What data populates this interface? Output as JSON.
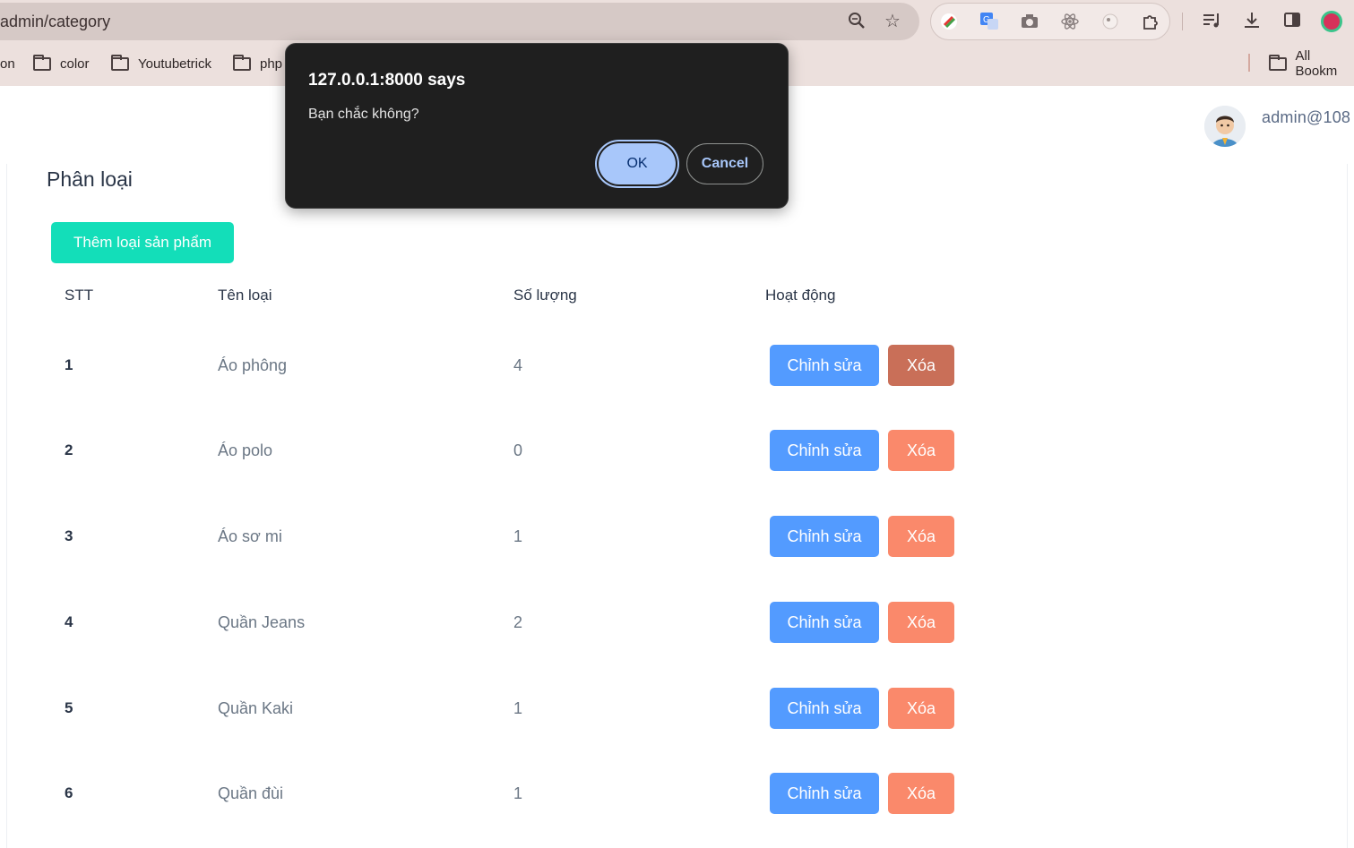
{
  "browser": {
    "url": "admin/category",
    "bookmarks": [
      "on",
      "color",
      "Youtubetrick",
      "php"
    ],
    "all_bookmarks": "All Bookm"
  },
  "header": {
    "username": "admin@108"
  },
  "main": {
    "title": "Phân loại",
    "add_button": "Thêm loại sản phẩm",
    "columns": [
      "STT",
      "Tên loại",
      "Số lượng",
      "Hoạt động"
    ],
    "edit_label": "Chỉnh sửa",
    "delete_label": "Xóa",
    "rows": [
      {
        "stt": "1",
        "name": "Áo phông",
        "qty": "4"
      },
      {
        "stt": "2",
        "name": "Áo polo",
        "qty": "0"
      },
      {
        "stt": "3",
        "name": "Áo sơ mi",
        "qty": "1"
      },
      {
        "stt": "4",
        "name": "Quần Jeans",
        "qty": "2"
      },
      {
        "stt": "5",
        "name": "Quần Kaki",
        "qty": "1"
      },
      {
        "stt": "6",
        "name": "Quần đùi",
        "qty": "1"
      }
    ]
  },
  "dialog": {
    "title": "127.0.0.1:8000 says",
    "message": "Bạn chắc không?",
    "ok": "OK",
    "cancel": "Cancel"
  },
  "colors": {
    "primary": "#539bff",
    "danger": "#fa896b",
    "accent": "#13deb9"
  }
}
